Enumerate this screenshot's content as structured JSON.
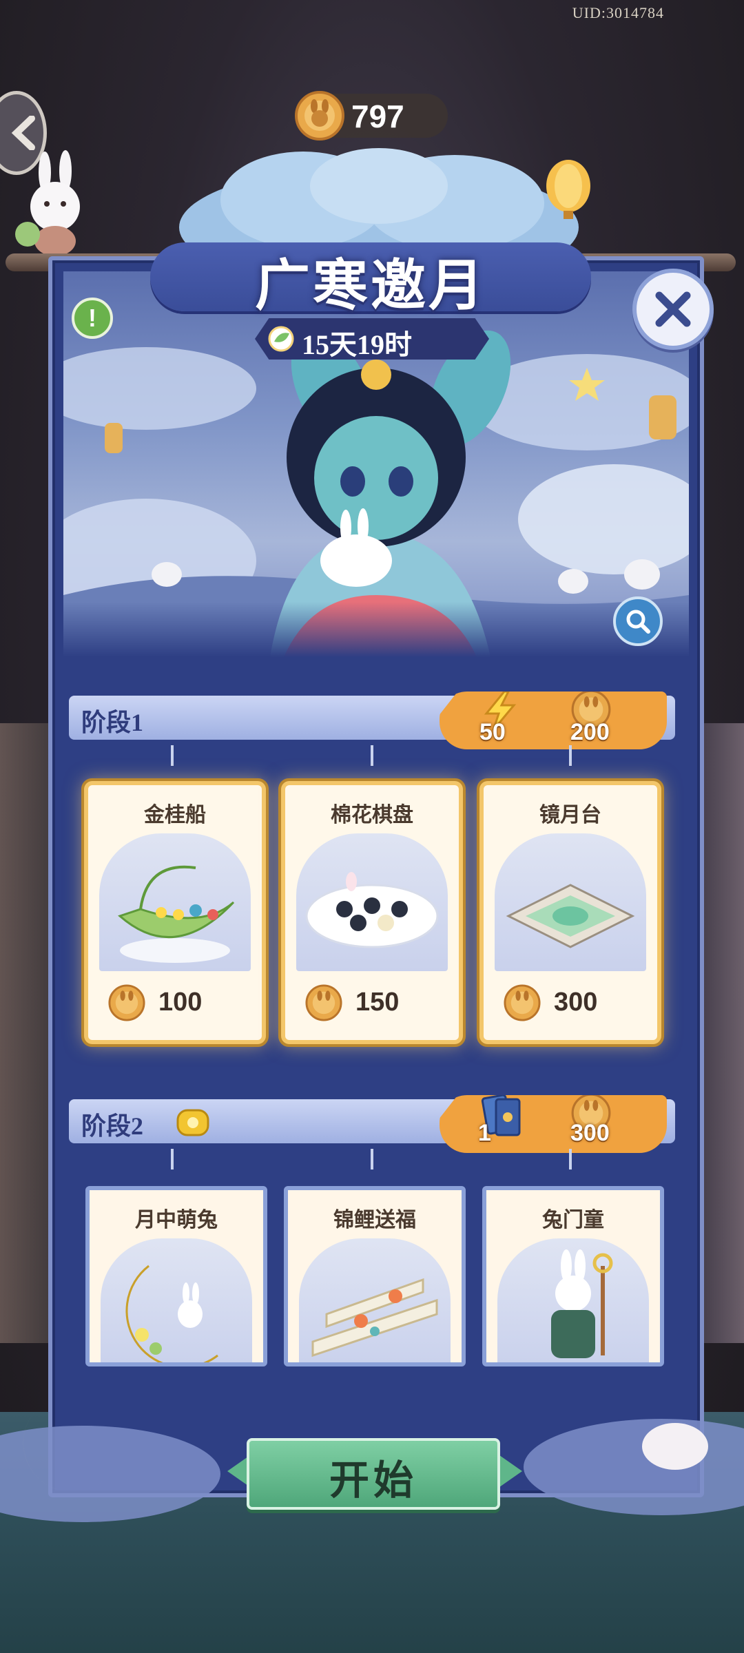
{
  "uid": "UID:3014784",
  "currency": {
    "amount": "797",
    "icon": "mooncake-coin-icon"
  },
  "event": {
    "title": "广寒邀月",
    "timer": "15天19时"
  },
  "stages": [
    {
      "label": "阶段1",
      "cost": {
        "energy": "50",
        "coins": "200"
      },
      "items": [
        {
          "name": "金桂船",
          "price": "100"
        },
        {
          "name": "棉花棋盘",
          "price": "150"
        },
        {
          "name": "镜月台",
          "price": "300"
        }
      ]
    },
    {
      "label": "阶段2",
      "cost": {
        "tickets": "1",
        "coins": "300"
      },
      "items": [
        {
          "name": "月中萌兔"
        },
        {
          "name": "锦鲤送福"
        },
        {
          "name": "兔门童"
        }
      ]
    }
  ],
  "start_label": "开始",
  "colors": {
    "panel": "#2e3f84",
    "accent_orange": "#f0a23f",
    "start_green": "#4fa77a"
  }
}
